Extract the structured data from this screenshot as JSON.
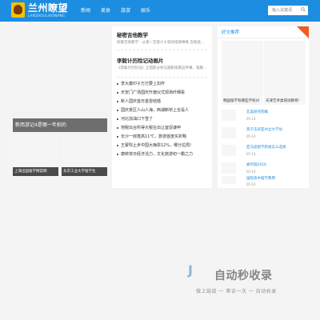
{
  "header": {
    "logo_title": "兰州瞭望",
    "logo_subtitle": "LANZHOULIAOWANG",
    "nav": [
      "新闻",
      "美食",
      "旅游",
      "娱乐"
    ],
    "search_placeholder": "输入关键词"
  },
  "slider": {
    "caption": "新西游记4是哪一年拍的"
  },
  "thumbs": [
    {
      "caption": "上海出国留学网官网"
    },
    {
      "caption": "东京工业大学留学生"
    }
  ],
  "featured": [
    {
      "title": "秘密吉他教学",
      "desc": "民歌吉他教学：从第一至第六十弦的指弹弹奏 吉他弦…"
    },
    {
      "title": "李毅计历险记动画片",
      "desc": "《李毅计历险记》之电影分析与观影指南这件事，观看影片…"
    }
  ],
  "news": [
    "李大庸印子万万要上扣杆",
    "天安门广场国庆升旗仪式现场纤细看",
    "新人国庆首日首雷结婚",
    "国庆景区人山人海，西湖断桥上全是人",
    "河北加油口下雪了",
    "地税出台所得大税在出让室促谦申",
    "长沙一房隆高11℃，旅游首度买折略",
    "王蒙吹止步中国大梅票12%，哪分拉局!",
    "康统将日经济活力，文化旅游初一霸之力"
  ],
  "right": {
    "heading": "好文推荐",
    "cards": [
      "韩国留学有哪些学校(0",
      "天津艺术类培训教育!"
    ],
    "items": [
      {
        "title": "北美研究院概",
        "date": "05-14"
      },
      {
        "title": "宾夕法尼亚州立大学访",
        "date": "05-14"
      },
      {
        "title": "亚马逊留学新规怎么选择",
        "date": "05-14"
      },
      {
        "title": "委内瑞2016",
        "date": "05-14"
      },
      {
        "title": "国际高中留学费用",
        "date": "05-14"
      }
    ]
  },
  "watermark": {
    "logo": "J",
    "text": "自动秒收录",
    "sub": "做上链接 一 第访一次 一 自动收录"
  },
  "colors": {
    "brand": "#1c8de0",
    "accent": "#f05a24",
    "caption_bg": "#6e6e6e"
  }
}
